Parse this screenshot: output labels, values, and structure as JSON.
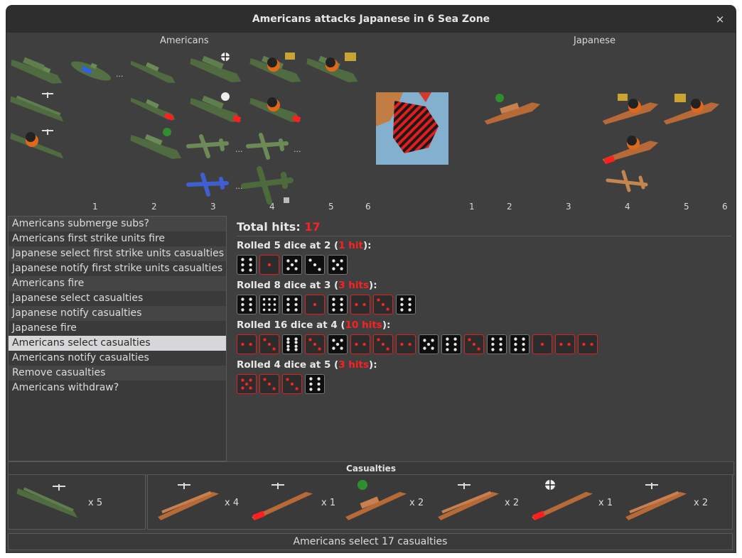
{
  "window": {
    "title": "Americans attacks Japanese in 6 Sea Zone",
    "close_glyph": "×"
  },
  "sides": {
    "attacker": "Americans",
    "defender": "Japanese"
  },
  "overflow_marker": "...",
  "column_numbers": [
    "1",
    "2",
    "3",
    "4",
    "5",
    "6"
  ],
  "steps": [
    "Americans submerge subs?",
    "Americans first strike units fire",
    "Japanese select first strike units casualties",
    "Japanese notify first strike units casualties",
    "Americans fire",
    "Japanese select casualties",
    "Japanese notify casualties",
    "Japanese fire",
    "Americans select casualties",
    "Americans notify casualties",
    "Remove casualties",
    "Americans withdraw?"
  ],
  "selected_step": 8,
  "total_hits": {
    "label": "Total hits:",
    "value": "17"
  },
  "rolls": [
    {
      "prefix": "Rolled 5 dice at 2 (",
      "hits": "1 hit",
      "suffix": "):",
      "dice": [
        6,
        1,
        5,
        3,
        5
      ]
    },
    {
      "prefix": "Rolled 8 dice at 3 (",
      "hits": "3 hits",
      "suffix": "):",
      "dice": [
        6,
        9,
        6,
        1,
        6,
        2,
        3,
        6
      ]
    },
    {
      "prefix": "Rolled 16 dice at 4 (",
      "hits": "10 hits",
      "suffix": "):",
      "dice": [
        2,
        3,
        8,
        3,
        5,
        2,
        3,
        2,
        5,
        6,
        3,
        6,
        6,
        1,
        2,
        2
      ]
    },
    {
      "prefix": "Rolled 4 dice at 5 (",
      "hits": "3 hits",
      "suffix": "):",
      "dice": [
        5,
        3,
        3,
        6
      ]
    }
  ],
  "roll_hit_threshold": [
    2,
    3,
    4,
    5
  ],
  "casualties": {
    "header": "Casualties",
    "american": [
      {
        "unit": "carrier",
        "count": "x 5"
      }
    ],
    "japanese": [
      {
        "unit": "carrier",
        "count": "x 4"
      },
      {
        "unit": "carrier-damaged",
        "count": "x 1"
      },
      {
        "unit": "cruiser-aa",
        "count": "x 2"
      },
      {
        "unit": "carrier",
        "count": "x 2"
      },
      {
        "unit": "battleship-target",
        "count": "x 1"
      },
      {
        "unit": "carrier",
        "count": "x 2"
      }
    ]
  },
  "status": "Americans select 17 casualties",
  "colors": {
    "us_hull": "#4f6b3f",
    "jp_hull": "#b76a38",
    "hit_red": "#ff2020",
    "window_bg": "#3f3f3f"
  }
}
